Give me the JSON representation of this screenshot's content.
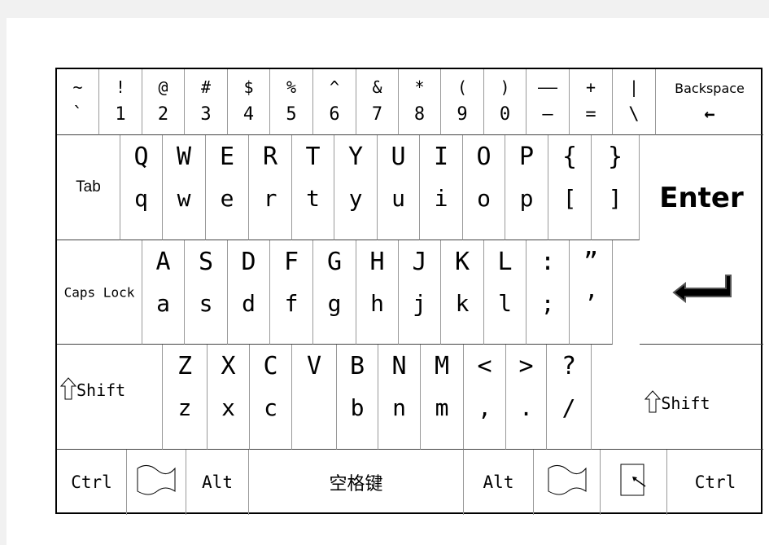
{
  "rows": [
    [
      {
        "up": "~",
        "lo": "`"
      },
      {
        "up": "!",
        "lo": "1"
      },
      {
        "up": "@",
        "lo": "2"
      },
      {
        "up": "#",
        "lo": "3"
      },
      {
        "up": "$",
        "lo": "4"
      },
      {
        "up": "%",
        "lo": "5"
      },
      {
        "up": "^",
        "lo": "6"
      },
      {
        "up": "&",
        "lo": "7"
      },
      {
        "up": "*",
        "lo": "8"
      },
      {
        "up": "(",
        "lo": "9"
      },
      {
        "up": ")",
        "lo": "0"
      },
      {
        "up": "——",
        "lo": "–"
      },
      {
        "up": "+",
        "lo": "="
      },
      {
        "up": "|",
        "lo": "\\"
      },
      {
        "up": "Backspace",
        "lo": "←"
      }
    ],
    [
      {
        "label": "Tab"
      },
      {
        "up": "Q",
        "lo": "q"
      },
      {
        "up": "W",
        "lo": "w"
      },
      {
        "up": "E",
        "lo": "e"
      },
      {
        "up": "R",
        "lo": "r"
      },
      {
        "up": "T",
        "lo": "t"
      },
      {
        "up": "Y",
        "lo": "y"
      },
      {
        "up": "U",
        "lo": "u"
      },
      {
        "up": "I",
        "lo": "i"
      },
      {
        "up": "O",
        "lo": "o"
      },
      {
        "up": "P",
        "lo": "p"
      },
      {
        "up": "{",
        "lo": "["
      },
      {
        "up": "}",
        "lo": "]"
      },
      {
        "label": "Enter"
      }
    ],
    [
      {
        "label": "Caps Lock"
      },
      {
        "up": "A",
        "lo": "a"
      },
      {
        "up": "S",
        "lo": "s"
      },
      {
        "up": "D",
        "lo": "d"
      },
      {
        "up": "F",
        "lo": "f"
      },
      {
        "up": "G",
        "lo": "g"
      },
      {
        "up": "H",
        "lo": "h"
      },
      {
        "up": "J",
        "lo": "j"
      },
      {
        "up": "K",
        "lo": "k"
      },
      {
        "up": "L",
        "lo": "l"
      },
      {
        "up": ":",
        "lo": ";"
      },
      {
        "up": "”",
        "lo": "’"
      }
    ],
    [
      {
        "label": "Shift",
        "icon": "shift-arrow-icon"
      },
      {
        "up": "Z",
        "lo": "z"
      },
      {
        "up": "X",
        "lo": "x"
      },
      {
        "up": "C",
        "lo": "c"
      },
      {
        "up": "V",
        "lo": ""
      },
      {
        "up": "B",
        "lo": "b"
      },
      {
        "up": "N",
        "lo": "n"
      },
      {
        "up": "M",
        "lo": "m"
      },
      {
        "up": "<",
        "lo": ","
      },
      {
        "up": ">",
        "lo": "."
      },
      {
        "up": "?",
        "lo": "/"
      },
      {
        "label": "Shift",
        "icon": "shift-arrow-icon"
      }
    ],
    [
      {
        "label": "Ctrl"
      },
      {
        "icon": "windows-flag-icon"
      },
      {
        "label": "Alt"
      },
      {
        "label": "空格键"
      },
      {
        "label": "Alt"
      },
      {
        "icon": "windows-flag-icon"
      },
      {
        "icon": "menu-key-icon"
      },
      {
        "label": "Ctrl"
      }
    ]
  ],
  "enter_icon": "enter-return-arrow-icon"
}
